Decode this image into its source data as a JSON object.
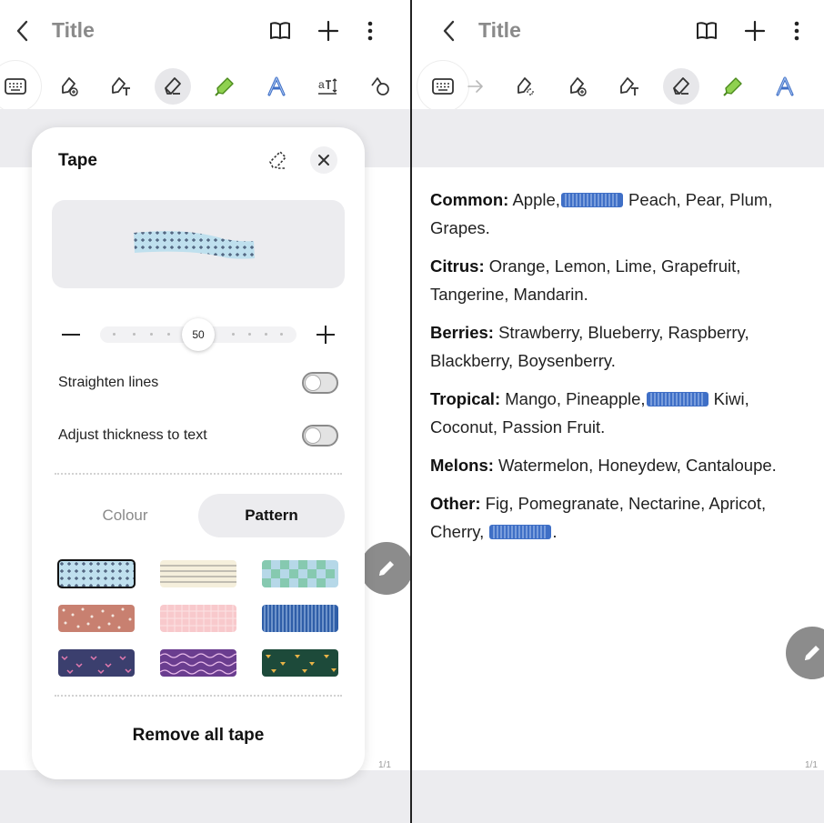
{
  "left": {
    "appbar": {
      "title": "Title"
    },
    "panel": {
      "title": "Tape",
      "size_value": "50",
      "options": [
        {
          "label": "Straighten lines",
          "enabled": false
        },
        {
          "label": "Adjust thickness to text",
          "enabled": false
        }
      ],
      "tabs": {
        "colour": "Colour",
        "pattern": "Pattern",
        "selected": "Pattern"
      },
      "remove_label": "Remove all tape"
    },
    "page_indicator": "1/1"
  },
  "right": {
    "appbar": {
      "title": "Title"
    },
    "notes": [
      {
        "heading": "Common:",
        "line1": "Apple,",
        "line1_after": " Peach, Pear, Plum,",
        "line2": "Grapes."
      },
      {
        "heading": "Citrus:",
        "line1": " Orange, Lemon, Lime, Grapefruit,",
        "line2": "Tangerine, Mandarin."
      },
      {
        "heading": "Berries:",
        "line1": " Strawberry, Blueberry, Raspberry,",
        "line2": "Blackberry, Boysenberry."
      },
      {
        "heading": "Tropical:",
        "line1": " Mango, Pineapple,",
        "line1_after": " Kiwi,",
        "line2": "Coconut, Passion Fruit."
      },
      {
        "heading": "Melons:",
        "line1": " Watermelon, Honeydew, Cantaloupe."
      },
      {
        "heading": "Other:",
        "line1": " Fig, Pomegranate, Nectarine, Apricot,",
        "line2": "Cherry,",
        "line2_after": "."
      }
    ],
    "page_indicator": "1/1"
  },
  "colors": {
    "accent_blue": "#3f6fc6",
    "panel_bg": "#ffffff",
    "gray_band": "#ececef"
  }
}
